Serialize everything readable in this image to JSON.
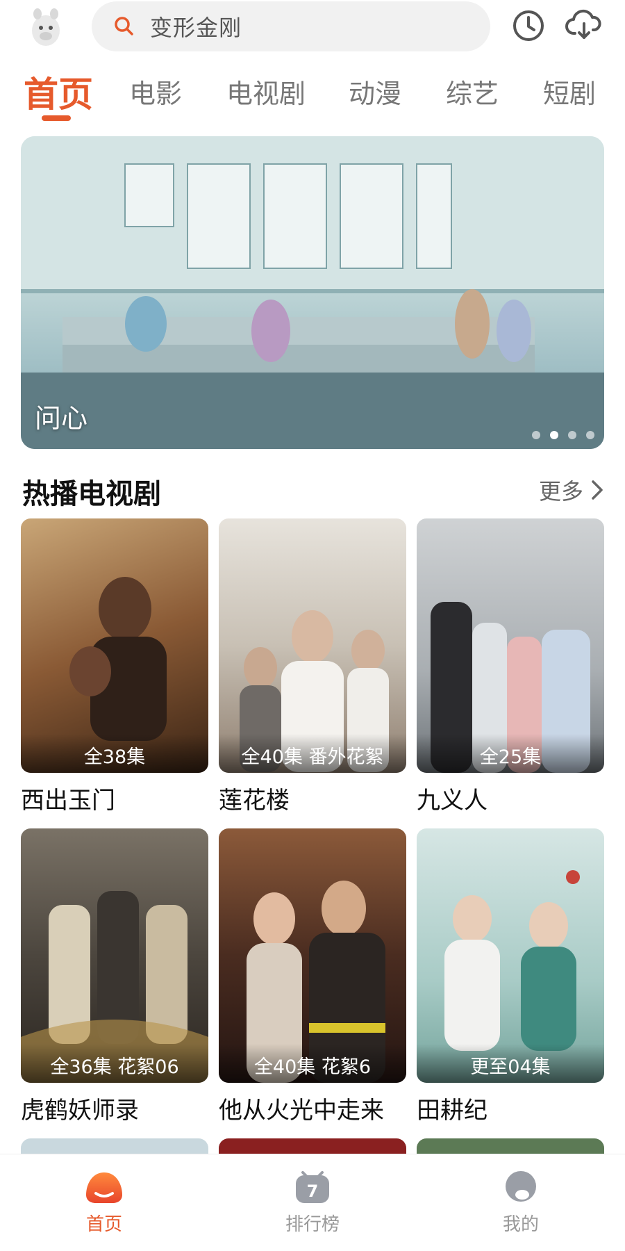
{
  "search": {
    "placeholder": "变形金刚"
  },
  "tabs": [
    {
      "label": "首页",
      "active": true
    },
    {
      "label": "电影"
    },
    {
      "label": "电视剧"
    },
    {
      "label": "动漫"
    },
    {
      "label": "综艺"
    },
    {
      "label": "短剧"
    }
  ],
  "banner": {
    "title": "问心",
    "slide_count": 4,
    "active_slide": 2
  },
  "section": {
    "title": "热播电视剧",
    "more_label": "更多"
  },
  "shows": [
    {
      "name": "西出玉门",
      "badge": "全38集"
    },
    {
      "name": "莲花楼",
      "badge": "全40集 番外花絮"
    },
    {
      "name": "九义人",
      "badge": "全25集"
    },
    {
      "name": "虎鹤妖师录",
      "badge": "全36集 花絮06"
    },
    {
      "name": "他从火光中走来",
      "badge": "全40集 花絮6"
    },
    {
      "name": "田耕纪",
      "badge": "更至04集"
    }
  ],
  "bottom_nav": [
    {
      "label": "首页",
      "active": true
    },
    {
      "label": "排行榜"
    },
    {
      "label": "我的"
    }
  ],
  "colors": {
    "accent": "#e65a2c",
    "inactive": "#999999"
  }
}
